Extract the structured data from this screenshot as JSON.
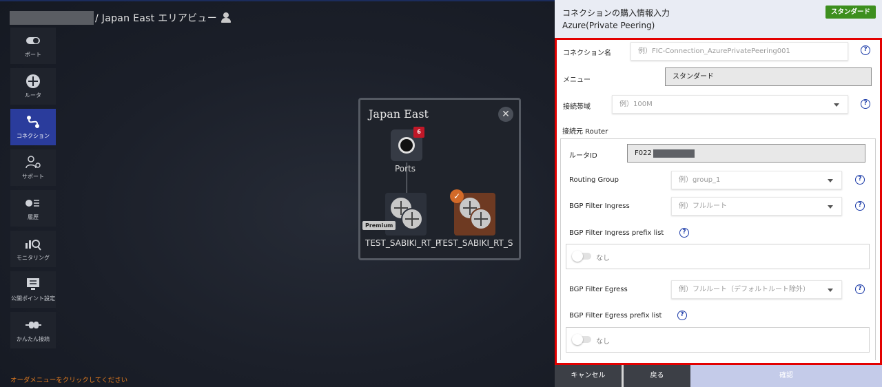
{
  "breadcrumb": {
    "title": "/ Japan East エリアビュー"
  },
  "sidebar": {
    "items": [
      {
        "label": "ポート",
        "icon": "port-icon"
      },
      {
        "label": "ルータ",
        "icon": "router-icon"
      },
      {
        "label": "コネクション",
        "icon": "connection-icon",
        "active": true
      },
      {
        "label": "サポート",
        "icon": "support-icon"
      },
      {
        "label": "履歴",
        "icon": "history-icon"
      },
      {
        "label": "モニタリング",
        "icon": "monitoring-icon"
      },
      {
        "label": "公開ポイント設定",
        "icon": "public-point-icon"
      },
      {
        "label": "かんたん接続",
        "icon": "easy-connect-icon"
      }
    ]
  },
  "hint": "オーダメニューをクリックしてください",
  "map": {
    "title": "Japan East",
    "ports_label": "Ports",
    "ports_badge": "6",
    "router1_label": "TEST_SABIKI_RT_P",
    "router1_badge": "Premium",
    "router2_label": "TEST_SABIKI_RT_S"
  },
  "panel": {
    "title": "コネクションの購入情報入力",
    "subtitle": "Azure(Private Peering)",
    "plan_badge": "スタンダード",
    "connection_name": {
      "label": "コネクション名",
      "placeholder": "例）FIC-Connection_AzurePrivatePeering001"
    },
    "menu": {
      "label": "メニュー",
      "value": "スタンダード"
    },
    "bandwidth": {
      "label": "接続帯域",
      "placeholder": "例）100M"
    },
    "source_section": "接続元 Router",
    "router_id": {
      "label": "ルータID",
      "value": "F022"
    },
    "routing_group": {
      "label": "Routing Group",
      "placeholder": "例）group_1"
    },
    "bgp_ingress": {
      "label": "BGP Filter Ingress",
      "placeholder": "例）フルルート"
    },
    "bgp_ingress_prefix": {
      "label": "BGP Filter Ingress prefix list",
      "toggle_text": "なし"
    },
    "bgp_egress": {
      "label": "BGP Filter Egress",
      "placeholder": "例）フルルート（デフォルトルート除外）"
    },
    "bgp_egress_prefix": {
      "label": "BGP Filter Egress prefix list",
      "toggle_text": "なし"
    },
    "help_glyph": "?"
  },
  "footer": {
    "cancel": "キャンセル",
    "back": "戻る",
    "confirm": "確認"
  },
  "colors": {
    "accent_blue": "#2a3c9c",
    "brand_green": "#3d8f1e",
    "highlight_red": "#e30000",
    "hint_orange": "#e07a1f"
  }
}
